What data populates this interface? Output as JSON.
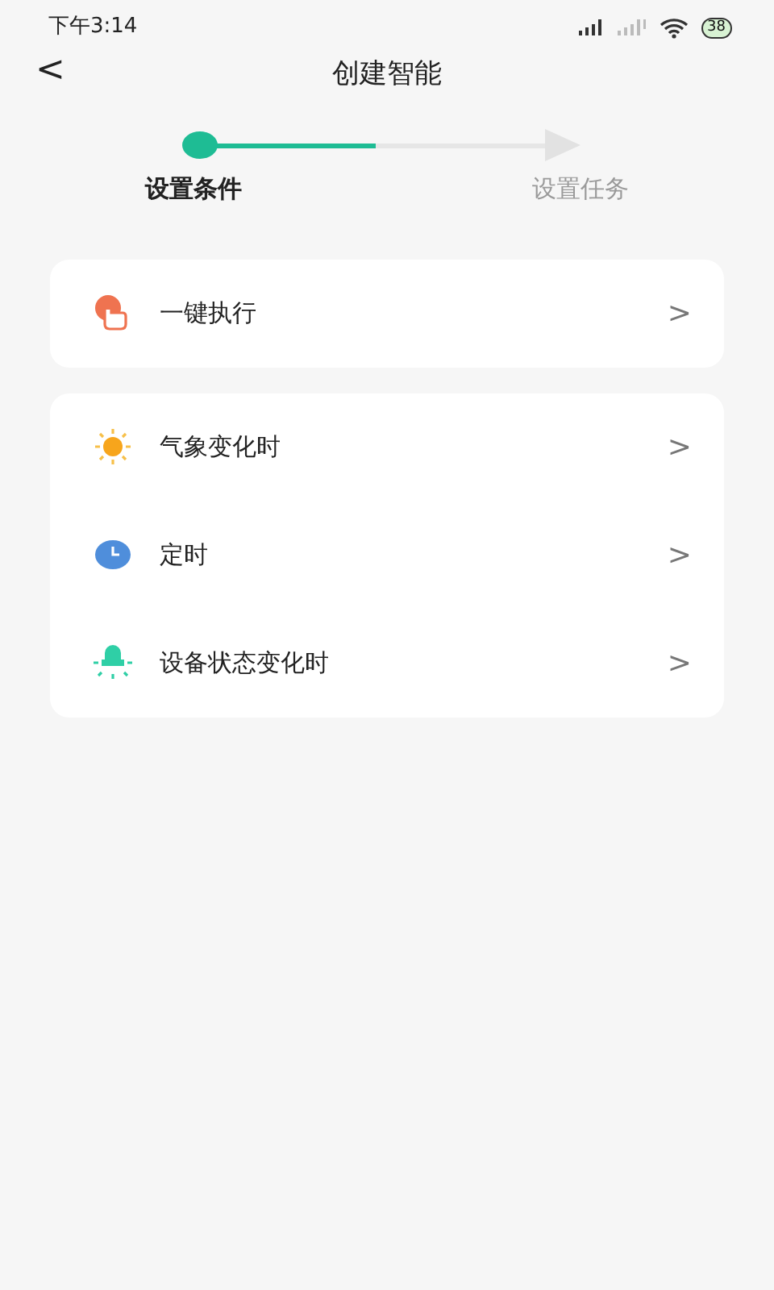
{
  "status_bar": {
    "time": "下午3:14",
    "battery": "38"
  },
  "header": {
    "back": "<",
    "title": "创建智能"
  },
  "progress": {
    "level": 0.5
  },
  "steps": [
    {
      "label": "设置条件",
      "selected": true
    },
    {
      "label": "设置任务",
      "selected": false
    }
  ],
  "groups": [
    {
      "items": [
        {
          "kind": "tap",
          "label": "一键执行",
          "chevron": ">"
        }
      ]
    },
    {
      "items": [
        {
          "kind": "weather",
          "label": "气象变化时",
          "chevron": ">"
        },
        {
          "kind": "timer",
          "label": "定时",
          "chevron": ">"
        },
        {
          "kind": "device",
          "label": "设备状态变化时",
          "chevron": ">"
        }
      ]
    }
  ]
}
